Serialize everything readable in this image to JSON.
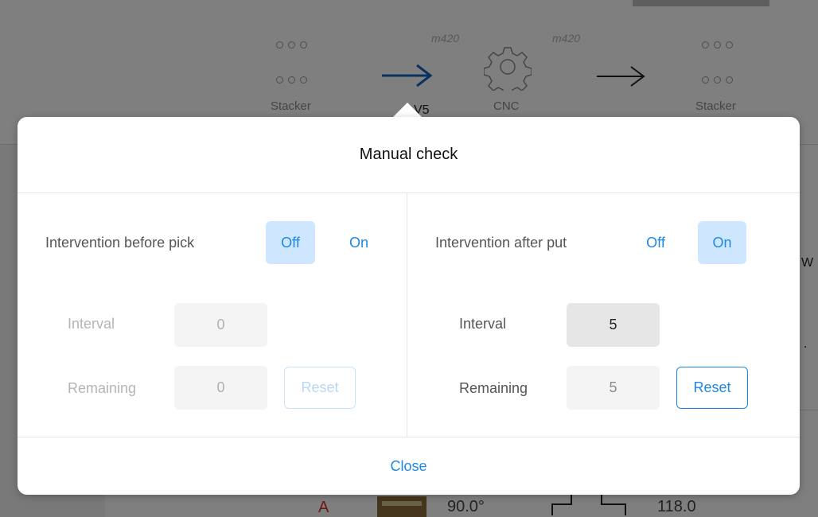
{
  "background": {
    "source_label": "Stacker",
    "machine_label": "CNC",
    "target_label": "Stacker",
    "model_left": "m420",
    "model_right": "m420",
    "partial_label": "V5",
    "bottom_letter": "A",
    "bottom_angle": "90.0°",
    "bottom_value": "118.0",
    "edge_text_1": "W",
    "edge_text_2": "."
  },
  "modal": {
    "title": "Manual check",
    "close_label": "Close",
    "left": {
      "intervention_label": "Intervention before pick",
      "off_label": "Off",
      "on_label": "On",
      "selected": "Off",
      "interval_label": "Interval",
      "interval_value": "0",
      "remaining_label": "Remaining",
      "remaining_value": "0",
      "reset_label": "Reset"
    },
    "right": {
      "intervention_label": "Intervention after put",
      "off_label": "Off",
      "on_label": "On",
      "selected": "On",
      "interval_label": "Interval",
      "interval_value": "5",
      "remaining_label": "Remaining",
      "remaining_value": "5",
      "reset_label": "Reset"
    }
  },
  "colors": {
    "accent": "#1e88e5",
    "selected_bg": "#cfe6ff",
    "flow_arrow_active": "#1565c0",
    "warning_red": "#d32f2f"
  }
}
